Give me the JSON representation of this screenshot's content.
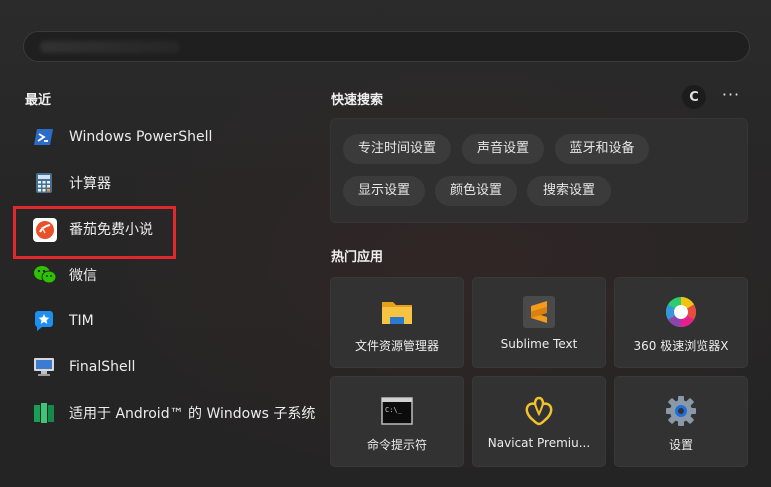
{
  "search": {
    "placeholder": ""
  },
  "recent": {
    "title": "最近",
    "items": [
      {
        "label": "Windows PowerShell",
        "icon": "powershell-icon"
      },
      {
        "label": "计算器",
        "icon": "calculator-icon"
      },
      {
        "label": "番茄免费小说",
        "icon": "fanqie-novel-icon"
      },
      {
        "label": "微信",
        "icon": "wechat-icon"
      },
      {
        "label": "TIM",
        "icon": "tim-icon"
      },
      {
        "label": "FinalShell",
        "icon": "finalshell-icon"
      },
      {
        "label": "适用于 Android™ 的 Windows 子系统",
        "icon": "wsa-icon"
      }
    ]
  },
  "quick_search": {
    "title": "快速搜索",
    "refresh_label": "C",
    "more_label": "···",
    "chips": [
      "专注时间设置",
      "声音设置",
      "蓝牙和设备",
      "显示设置",
      "颜色设置",
      "搜索设置"
    ]
  },
  "hot_apps": {
    "title": "热门应用",
    "tiles": [
      {
        "label": "文件资源管理器",
        "icon": "folder-icon"
      },
      {
        "label": "Sublime Text",
        "icon": "sublime-icon"
      },
      {
        "label": "360 极速浏览器X",
        "icon": "browser-360-icon"
      },
      {
        "label": "命令提示符",
        "icon": "cmd-icon"
      },
      {
        "label": "Navicat Premiu...",
        "icon": "navicat-icon"
      },
      {
        "label": "设置",
        "icon": "settings-gear-icon"
      }
    ]
  },
  "colors": {
    "highlight": "#e0282d",
    "accent_orange": "#f6a319"
  }
}
